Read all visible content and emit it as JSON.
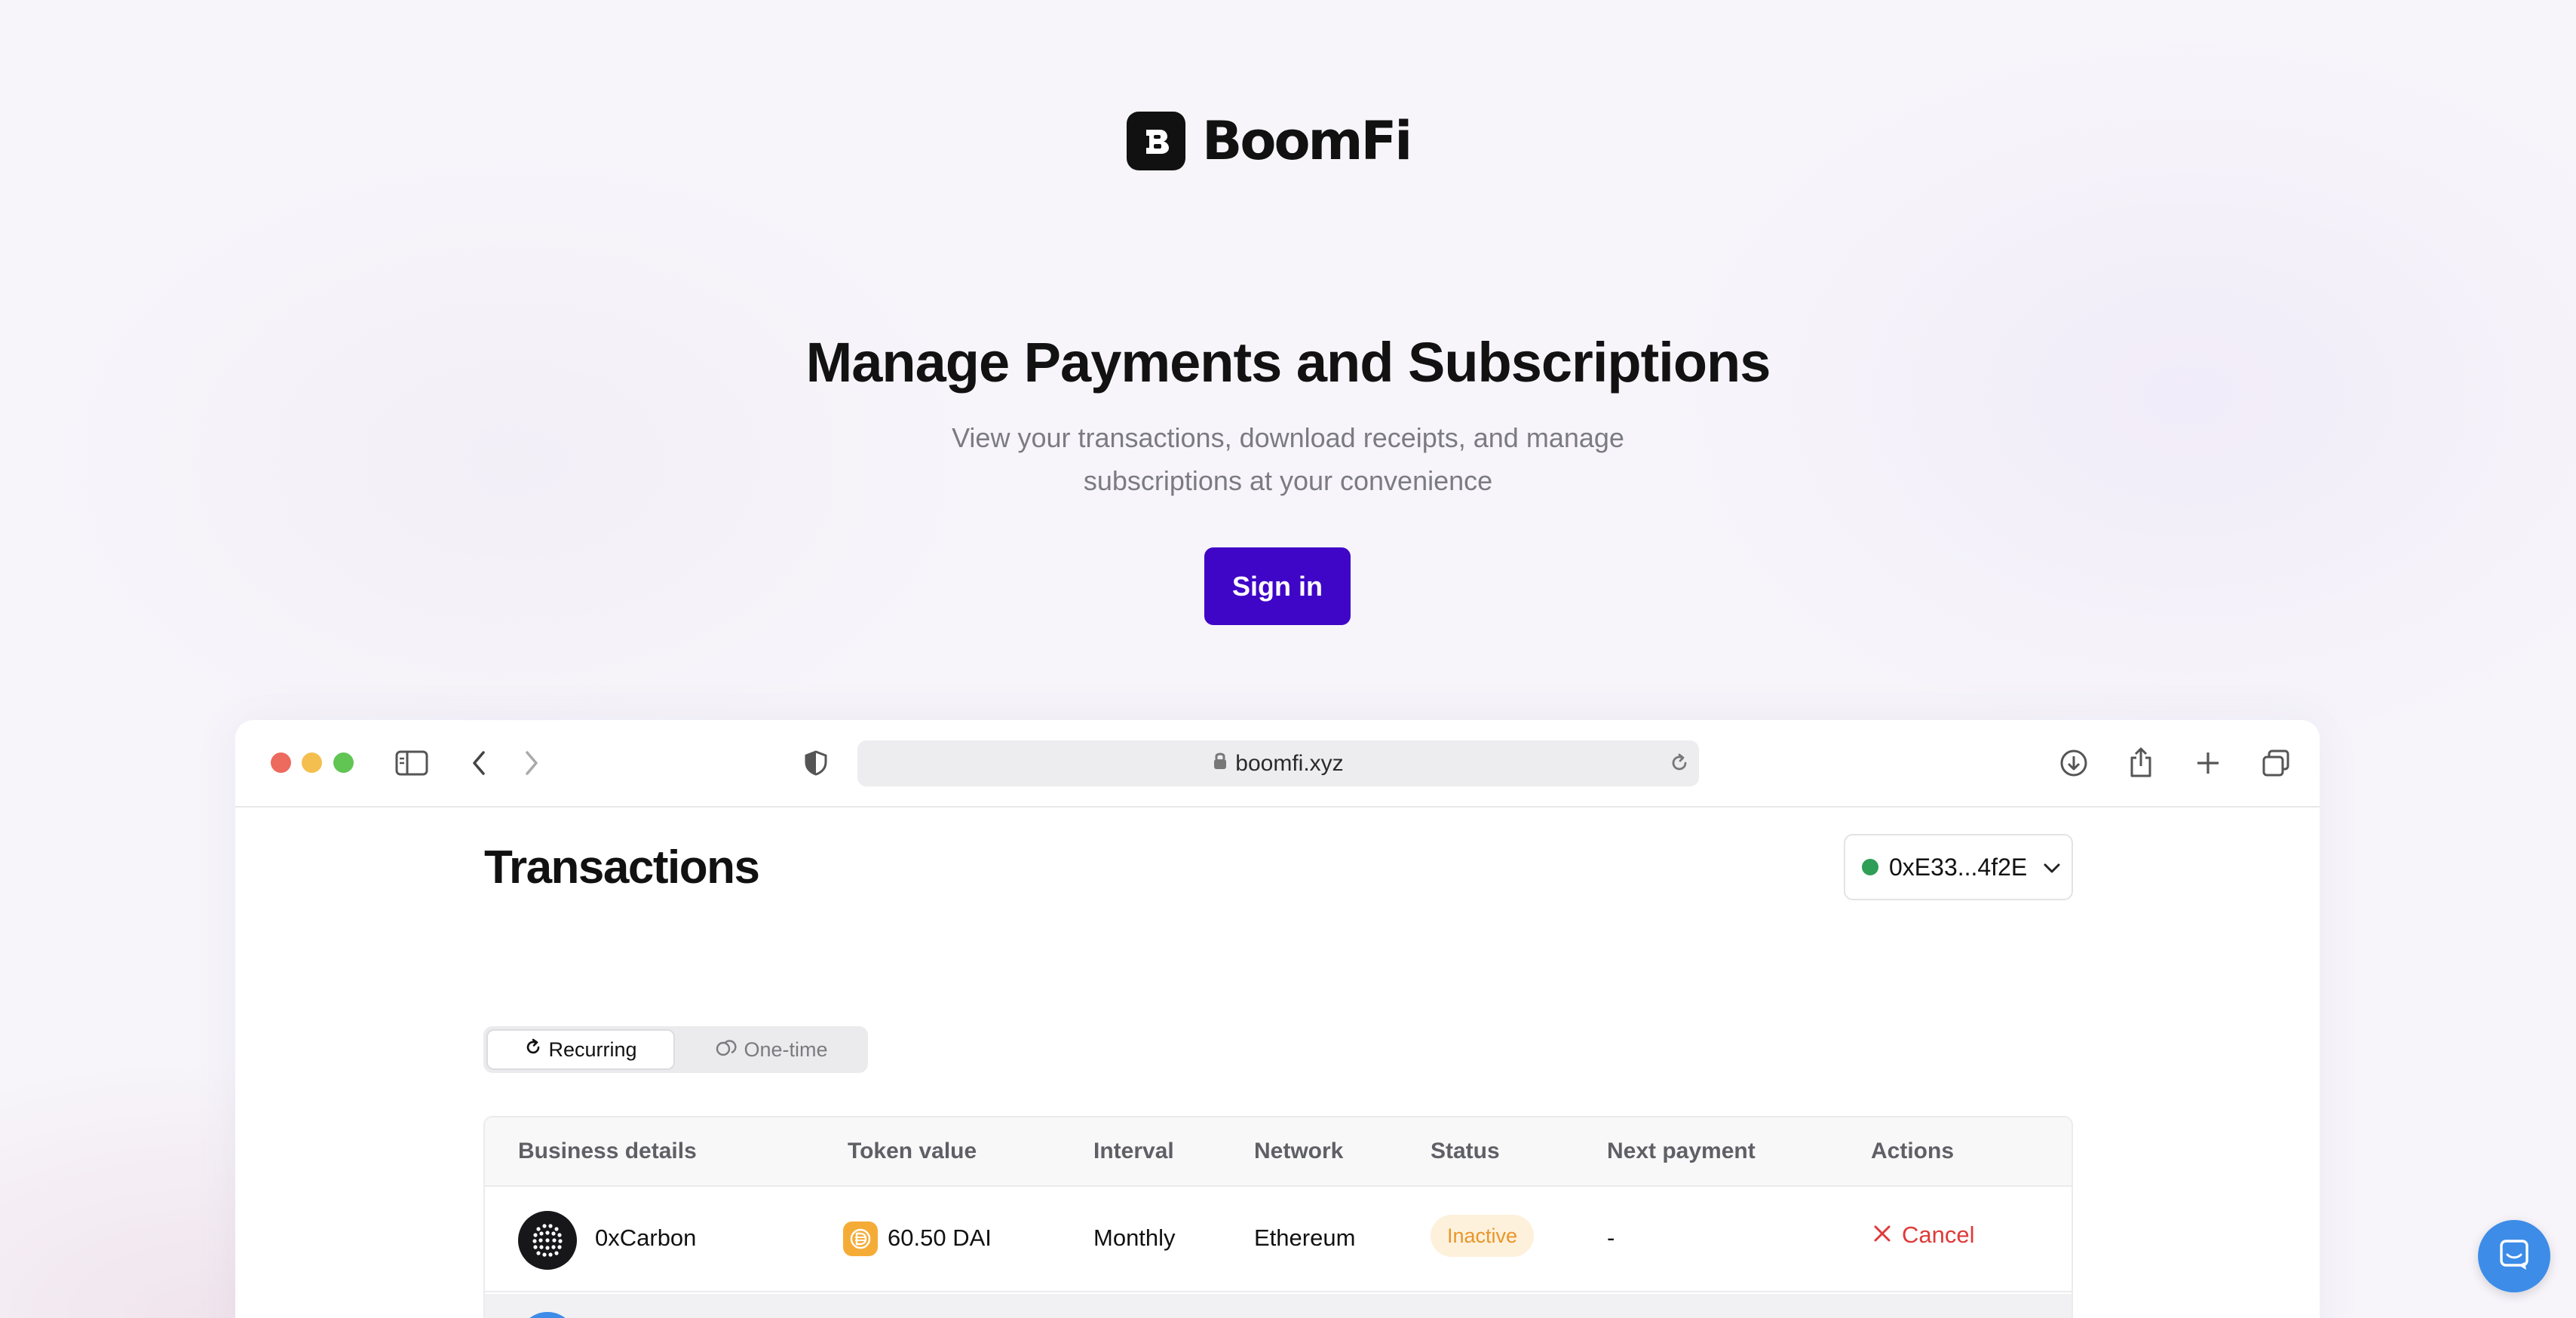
{
  "brand": {
    "name": "BoomFi",
    "mark_letter": "B"
  },
  "hero": {
    "title": "Manage Payments and Subscriptions",
    "subtitle_line1": "View your transactions, download receipts, and manage",
    "subtitle_line2": "subscriptions at your convenience",
    "signin_label": "Sign in"
  },
  "browser": {
    "url": "boomfi.xyz",
    "icons": [
      "sidebar-icon",
      "back-icon",
      "forward-icon",
      "shield-icon",
      "lock-icon",
      "reload-icon",
      "download-icon",
      "share-icon",
      "new-tab-icon",
      "tabs-overview-icon"
    ]
  },
  "app": {
    "page_title": "Transactions",
    "wallet": {
      "address": "0xE33...4f2E",
      "status_color": "#2f9e56"
    },
    "tabs": [
      {
        "label": "Recurring",
        "active": true
      },
      {
        "label": "One-time",
        "active": false
      }
    ],
    "table": {
      "headers": [
        "Business details",
        "Token value",
        "Interval",
        "Network",
        "Status",
        "Next payment",
        "Actions"
      ],
      "rows": [
        {
          "business": "0xCarbon",
          "token_value": "60.50 DAI",
          "interval": "Monthly",
          "network": "Ethereum",
          "status": "Inactive",
          "next_payment": "-",
          "action": "Cancel"
        }
      ]
    }
  },
  "colors": {
    "accent": "#4006c7",
    "inactive_badge": "#e9962a",
    "cancel": "#df3a3a",
    "chat": "#3d8ce8"
  }
}
